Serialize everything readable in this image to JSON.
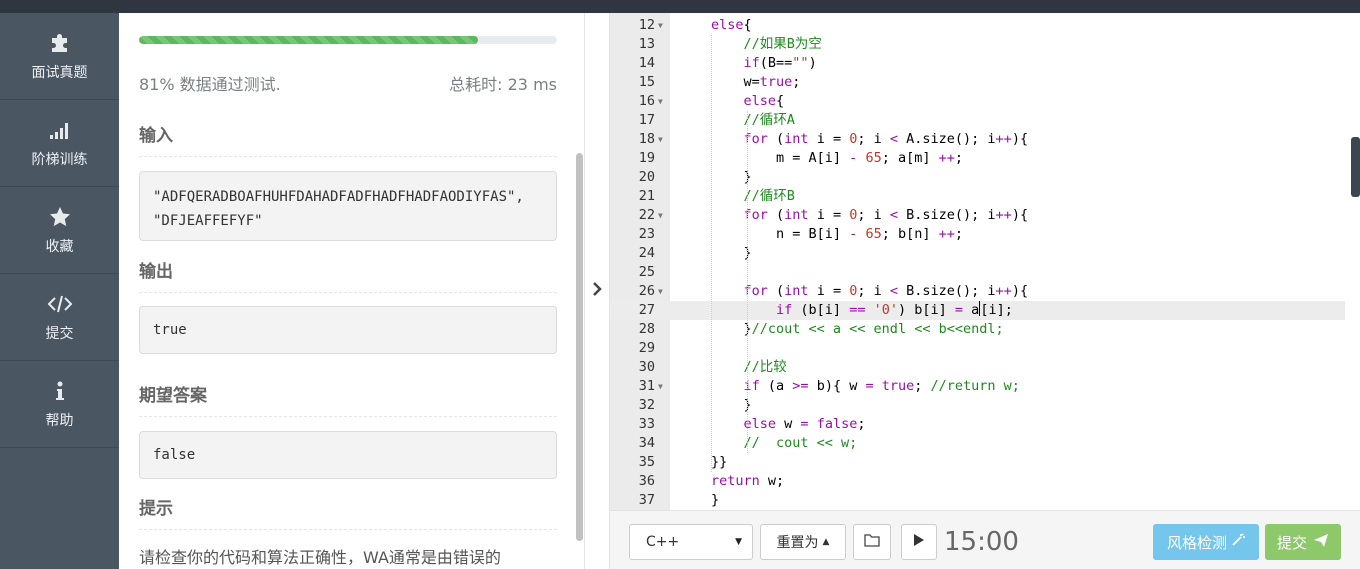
{
  "nav": {
    "items": [
      {
        "label": "面试真题",
        "icon": "puzzle-icon"
      },
      {
        "label": "阶梯训练",
        "icon": "signal-bars-icon"
      },
      {
        "label": "收藏",
        "icon": "star-icon"
      },
      {
        "label": "提交",
        "icon": "code-icon"
      },
      {
        "label": "帮助",
        "icon": "info-icon"
      }
    ]
  },
  "result": {
    "progress_percent": 81,
    "pass_text": "81% 数据通过测试.",
    "time_text": "总耗时: 23 ms",
    "input_title": "输入",
    "input_value": "\"ADFQERADBOAFHUHFDAHADFADFHADFHADFAODIYFAS\", \"DFJEAFFEFYF\"",
    "output_title": "输出",
    "output_value": "true",
    "expected_title": "期望答案",
    "expected_value": "false",
    "hint_title": "提示",
    "hint_text": "请检查你的代码和算法正确性，WA通常是由错误的"
  },
  "editor": {
    "active_line": 27,
    "lines": [
      {
        "n": "12",
        "fold": true
      },
      {
        "n": "13",
        "fold": false
      },
      {
        "n": "14",
        "fold": false
      },
      {
        "n": "15",
        "fold": false
      },
      {
        "n": "16",
        "fold": true
      },
      {
        "n": "17",
        "fold": false
      },
      {
        "n": "18",
        "fold": true
      },
      {
        "n": "19",
        "fold": false
      },
      {
        "n": "20",
        "fold": false
      },
      {
        "n": "21",
        "fold": false
      },
      {
        "n": "22",
        "fold": true
      },
      {
        "n": "23",
        "fold": false
      },
      {
        "n": "24",
        "fold": false
      },
      {
        "n": "25",
        "fold": false
      },
      {
        "n": "26",
        "fold": true
      },
      {
        "n": "27",
        "fold": false
      },
      {
        "n": "28",
        "fold": false
      },
      {
        "n": "29",
        "fold": false
      },
      {
        "n": "30",
        "fold": false
      },
      {
        "n": "31",
        "fold": true
      },
      {
        "n": "32",
        "fold": false
      },
      {
        "n": "33",
        "fold": false
      },
      {
        "n": "34",
        "fold": false
      },
      {
        "n": "35",
        "fold": false
      },
      {
        "n": "36",
        "fold": false
      },
      {
        "n": "37",
        "fold": false
      }
    ],
    "code": [
      [
        {
          "t": "else",
          "c": "kw"
        },
        {
          "t": "{",
          "c": ""
        }
      ],
      [
        {
          "t": "    //如果B为空",
          "c": "cmt"
        }
      ],
      [
        {
          "t": "    ",
          "c": ""
        },
        {
          "t": "if",
          "c": "kw"
        },
        {
          "t": "(B==",
          "c": ""
        },
        {
          "t": "\"\"",
          "c": "str"
        },
        {
          "t": ")",
          "c": ""
        }
      ],
      [
        {
          "t": "    w=",
          "c": ""
        },
        {
          "t": "true",
          "c": "kw"
        },
        {
          "t": ";",
          "c": ""
        }
      ],
      [
        {
          "t": "    ",
          "c": ""
        },
        {
          "t": "else",
          "c": "kw"
        },
        {
          "t": "{",
          "c": ""
        }
      ],
      [
        {
          "t": "    //循环A",
          "c": "cmt"
        }
      ],
      [
        {
          "t": "    ",
          "c": ""
        },
        {
          "t": "for",
          "c": "kw"
        },
        {
          "t": " (",
          "c": ""
        },
        {
          "t": "int",
          "c": "typ"
        },
        {
          "t": " i = ",
          "c": ""
        },
        {
          "t": "0",
          "c": "num"
        },
        {
          "t": "; i ",
          "c": ""
        },
        {
          "t": "<",
          "c": "kw"
        },
        {
          "t": " A.size(); i",
          "c": ""
        },
        {
          "t": "++",
          "c": "kw"
        },
        {
          "t": "){",
          "c": ""
        }
      ],
      [
        {
          "t": "        m = A[i] ",
          "c": ""
        },
        {
          "t": "-",
          "c": "kw"
        },
        {
          "t": " ",
          "c": ""
        },
        {
          "t": "65",
          "c": "num"
        },
        {
          "t": "; a[m] ",
          "c": ""
        },
        {
          "t": "++",
          "c": "kw"
        },
        {
          "t": ";",
          "c": ""
        }
      ],
      [
        {
          "t": "    }",
          "c": ""
        }
      ],
      [
        {
          "t": "    //循环B",
          "c": "cmt"
        }
      ],
      [
        {
          "t": "    ",
          "c": ""
        },
        {
          "t": "for",
          "c": "kw"
        },
        {
          "t": " (",
          "c": ""
        },
        {
          "t": "int",
          "c": "typ"
        },
        {
          "t": " i = ",
          "c": ""
        },
        {
          "t": "0",
          "c": "num"
        },
        {
          "t": "; i ",
          "c": ""
        },
        {
          "t": "<",
          "c": "kw"
        },
        {
          "t": " B.size(); i",
          "c": ""
        },
        {
          "t": "++",
          "c": "kw"
        },
        {
          "t": "){",
          "c": ""
        }
      ],
      [
        {
          "t": "        n = B[i] ",
          "c": ""
        },
        {
          "t": "-",
          "c": "kw"
        },
        {
          "t": " ",
          "c": ""
        },
        {
          "t": "65",
          "c": "num"
        },
        {
          "t": "; b[n] ",
          "c": ""
        },
        {
          "t": "++",
          "c": "kw"
        },
        {
          "t": ";",
          "c": ""
        }
      ],
      [
        {
          "t": "    }",
          "c": ""
        }
      ],
      [
        {
          "t": "",
          "c": ""
        }
      ],
      [
        {
          "t": "    ",
          "c": ""
        },
        {
          "t": "for",
          "c": "kw"
        },
        {
          "t": " (",
          "c": ""
        },
        {
          "t": "int",
          "c": "typ"
        },
        {
          "t": " i = ",
          "c": ""
        },
        {
          "t": "0",
          "c": "num"
        },
        {
          "t": "; i ",
          "c": ""
        },
        {
          "t": "<",
          "c": "kw"
        },
        {
          "t": " B.size(); i",
          "c": ""
        },
        {
          "t": "++",
          "c": "kw"
        },
        {
          "t": "){",
          "c": ""
        }
      ],
      [
        {
          "t": "        ",
          "c": ""
        },
        {
          "t": "if",
          "c": "kw"
        },
        {
          "t": " (b[i] ",
          "c": ""
        },
        {
          "t": "==",
          "c": "kw"
        },
        {
          "t": " ",
          "c": ""
        },
        {
          "t": "'0'",
          "c": "str"
        },
        {
          "t": ") b[i] ",
          "c": ""
        },
        {
          "t": "=",
          "c": "kw"
        },
        {
          "t": " a",
          "c": ""
        },
        {
          "t": "|",
          "c": "cursor"
        },
        {
          "t": "[i];",
          "c": ""
        }
      ],
      [
        {
          "t": "    }",
          "c": ""
        },
        {
          "t": "//cout << a << endl << b<<endl;",
          "c": "cmt"
        }
      ],
      [
        {
          "t": "",
          "c": ""
        }
      ],
      [
        {
          "t": "    //比较",
          "c": "cmt"
        }
      ],
      [
        {
          "t": "    ",
          "c": ""
        },
        {
          "t": "if",
          "c": "kw"
        },
        {
          "t": " (a ",
          "c": ""
        },
        {
          "t": ">=",
          "c": "kw"
        },
        {
          "t": " b){ w ",
          "c": ""
        },
        {
          "t": "=",
          "c": "kw"
        },
        {
          "t": " ",
          "c": ""
        },
        {
          "t": "true",
          "c": "kw"
        },
        {
          "t": "; ",
          "c": ""
        },
        {
          "t": "//return w;",
          "c": "cmt"
        }
      ],
      [
        {
          "t": "    }",
          "c": ""
        }
      ],
      [
        {
          "t": "    ",
          "c": ""
        },
        {
          "t": "else",
          "c": "kw"
        },
        {
          "t": " w ",
          "c": ""
        },
        {
          "t": "=",
          "c": "kw"
        },
        {
          "t": " ",
          "c": ""
        },
        {
          "t": "false",
          "c": "kw"
        },
        {
          "t": ";",
          "c": ""
        }
      ],
      [
        {
          "t": "    //  cout << w;",
          "c": "cmt"
        }
      ],
      [
        {
          "t": "}}",
          "c": ""
        }
      ],
      [
        {
          "t": "return",
          "c": "kw"
        },
        {
          "t": " w;",
          "c": ""
        }
      ],
      [
        {
          "t": "}",
          "c": ""
        }
      ]
    ]
  },
  "toolbar": {
    "language": "C++",
    "reset_label": "重置为",
    "timer": "15:00",
    "style_check_label": "风格检测",
    "submit_label": "提交"
  },
  "colors": {
    "nav_bg": "#4b5663",
    "progress": "#5cb85c",
    "style_btn": "#74c6ec",
    "submit_btn": "#8dc86a"
  }
}
